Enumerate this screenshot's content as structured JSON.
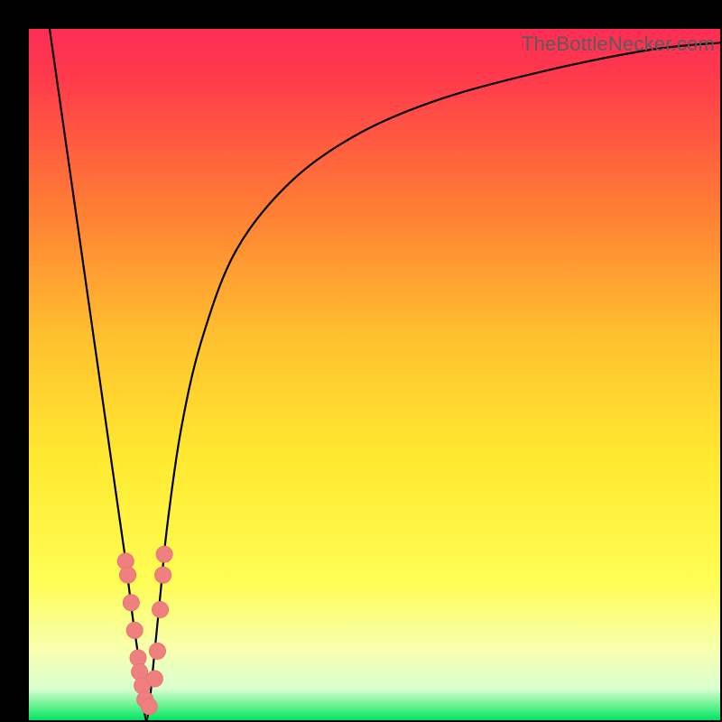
{
  "watermark": "TheBottleNecker.com",
  "colors": {
    "gradient_top": "#ff2d55",
    "gradient_upper_mid": "#ff8a2a",
    "gradient_mid": "#ffee33",
    "gradient_low": "#fbffa8",
    "gradient_bottom": "#00e565",
    "curve": "#000000",
    "marker_fill": "#f08080",
    "marker_stroke": "#e57373",
    "frame_bg": "#000000"
  },
  "chart_data": {
    "type": "line",
    "title": "",
    "xlabel": "",
    "ylabel": "",
    "xlim": [
      0,
      100
    ],
    "ylim": [
      0,
      100
    ],
    "optimum_x": 17,
    "series": [
      {
        "name": "bottleneck-curve",
        "x": [
          3,
          5,
          7,
          9,
          11,
          13,
          14,
          15,
          16,
          16.5,
          17,
          17.5,
          18,
          19,
          20,
          22,
          25,
          30,
          38,
          48,
          60,
          75,
          90,
          100
        ],
        "values": [
          100,
          86,
          72,
          58,
          44,
          30,
          23,
          15,
          8,
          3,
          0,
          3,
          8,
          18,
          28,
          42,
          55,
          68,
          78,
          85,
          90,
          94,
          97,
          98
        ]
      }
    ],
    "markers": {
      "name": "highlighted-points",
      "x": [
        14.0,
        14.3,
        14.8,
        15.3,
        15.8,
        16.0,
        16.4,
        16.8,
        17.4,
        18.2,
        18.6,
        19.0,
        19.4,
        19.6
      ],
      "values": [
        23,
        21,
        17,
        13,
        9,
        7,
        5,
        3,
        2,
        6,
        10,
        16,
        21,
        24
      ]
    }
  }
}
